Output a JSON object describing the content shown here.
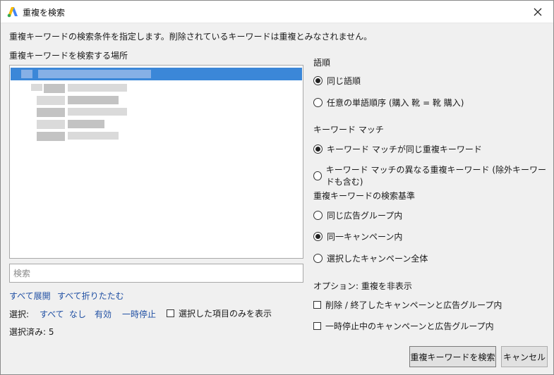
{
  "window": {
    "title": "重複を検索"
  },
  "instruction": "重複キーワードの検索条件を指定します。削除されているキーワードは重複とみなされません。",
  "location": {
    "label": "重複キーワードを検索する場所",
    "search_placeholder": "検索",
    "expand_all": "すべて展開",
    "collapse_all": "すべて折りたたむ"
  },
  "selection": {
    "label": "選択:",
    "all": "すべて",
    "none": "なし",
    "enabled": "有効",
    "paused": "一時停止",
    "show_selected_only": "選択した項目のみを表示",
    "show_selected_only_checked": false,
    "selected_count_text": "選択済み: 5"
  },
  "word_order": {
    "label": "語順",
    "options": [
      {
        "label": "同じ語順",
        "selected": true
      },
      {
        "label": "任意の単語順序 (購入 靴 = 靴 購入)",
        "selected": false
      }
    ]
  },
  "match_type": {
    "label": "キーワード マッチ",
    "options": [
      {
        "label": "キーワード マッチが同じ重複キーワード",
        "selected": true
      },
      {
        "label": "キーワード マッチの異なる重複キーワード (除外キーワードも含む)",
        "selected": false
      }
    ]
  },
  "search_scope": {
    "label": "重複キーワードの検索基準",
    "options": [
      {
        "label": "同じ広告グループ内",
        "selected": false
      },
      {
        "label": "同一キャンペーン内",
        "selected": true
      },
      {
        "label": "選択したキャンペーン全体",
        "selected": false
      }
    ]
  },
  "hide_options": {
    "label": "オプション:  重複を非表示",
    "options": [
      {
        "label": "削除 / 終了したキャンペーンと広告グループ内",
        "checked": false
      },
      {
        "label": "一時停止中のキャンペーンと広告グループ内",
        "checked": false
      }
    ]
  },
  "buttons": {
    "find": "重複キーワードを検索",
    "cancel": "キャンセル"
  },
  "colors": {
    "selection": "#3b87d8",
    "link": "#1f4fa3",
    "logo_blue": "#4285f4",
    "logo_yellow": "#fbbc04"
  }
}
